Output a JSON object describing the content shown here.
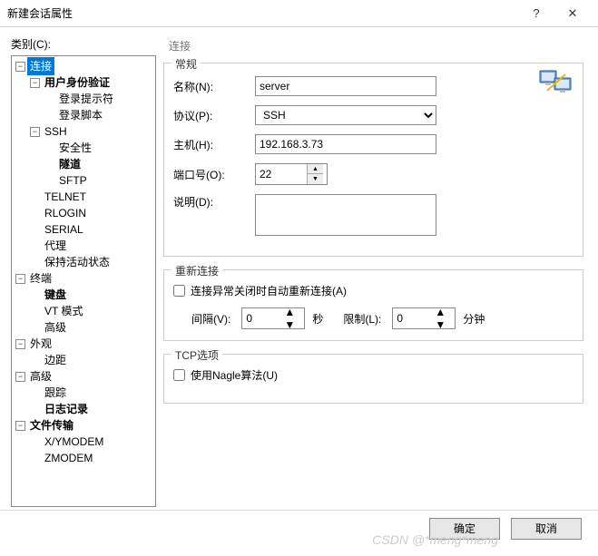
{
  "titlebar": {
    "title": "新建会话属性",
    "help": "?",
    "close": "✕"
  },
  "left": {
    "label": "类别(C):",
    "tree": [
      {
        "indent": 0,
        "toggle": "−",
        "label": "连接",
        "sel": true,
        "bold": false
      },
      {
        "indent": 1,
        "toggle": "−",
        "label": "用户身份验证",
        "bold": true
      },
      {
        "indent": 2,
        "toggle": "",
        "label": "登录提示符"
      },
      {
        "indent": 2,
        "toggle": "",
        "label": "登录脚本"
      },
      {
        "indent": 1,
        "toggle": "−",
        "label": "SSH"
      },
      {
        "indent": 2,
        "toggle": "",
        "label": "安全性"
      },
      {
        "indent": 2,
        "toggle": "",
        "label": "隧道",
        "bold": true
      },
      {
        "indent": 2,
        "toggle": "",
        "label": "SFTP"
      },
      {
        "indent": 1,
        "toggle": "",
        "label": "TELNET"
      },
      {
        "indent": 1,
        "toggle": "",
        "label": "RLOGIN"
      },
      {
        "indent": 1,
        "toggle": "",
        "label": "SERIAL"
      },
      {
        "indent": 1,
        "toggle": "",
        "label": "代理"
      },
      {
        "indent": 1,
        "toggle": "",
        "label": "保持活动状态"
      },
      {
        "indent": 0,
        "toggle": "−",
        "label": "终端"
      },
      {
        "indent": 1,
        "toggle": "",
        "label": "键盘",
        "bold": true
      },
      {
        "indent": 1,
        "toggle": "",
        "label": "VT 模式"
      },
      {
        "indent": 1,
        "toggle": "",
        "label": "高级"
      },
      {
        "indent": 0,
        "toggle": "−",
        "label": "外观"
      },
      {
        "indent": 1,
        "toggle": "",
        "label": "边距"
      },
      {
        "indent": 0,
        "toggle": "−",
        "label": "高级"
      },
      {
        "indent": 1,
        "toggle": "",
        "label": "跟踪"
      },
      {
        "indent": 1,
        "toggle": "",
        "label": "日志记录",
        "bold": true
      },
      {
        "indent": 0,
        "toggle": "−",
        "label": "文件传输",
        "bold": true
      },
      {
        "indent": 1,
        "toggle": "",
        "label": "X/YMODEM"
      },
      {
        "indent": 1,
        "toggle": "",
        "label": "ZMODEM"
      }
    ]
  },
  "right": {
    "heading": "连接",
    "general": {
      "legend": "常规",
      "name_label": "名称(N):",
      "name_value": "server",
      "proto_label": "协议(P):",
      "proto_value": "SSH",
      "host_label": "主机(H):",
      "host_value": "192.168.3.73",
      "port_label": "端口号(O):",
      "port_value": "22",
      "desc_label": "说明(D):",
      "desc_value": ""
    },
    "reconnect": {
      "legend": "重新连接",
      "chk_label": "连接异常关闭时自动重新连接(A)",
      "interval_label": "间隔(V):",
      "interval_value": "0",
      "sec": "秒",
      "limit_label": "限制(L):",
      "limit_value": "0",
      "min": "分钟"
    },
    "tcp": {
      "legend": "TCP选项",
      "nagle_label": "使用Nagle算法(U)"
    }
  },
  "footer": {
    "ok": "确定",
    "cancel": "取消"
  },
  "watermark": "CSDN @*meng*meng"
}
